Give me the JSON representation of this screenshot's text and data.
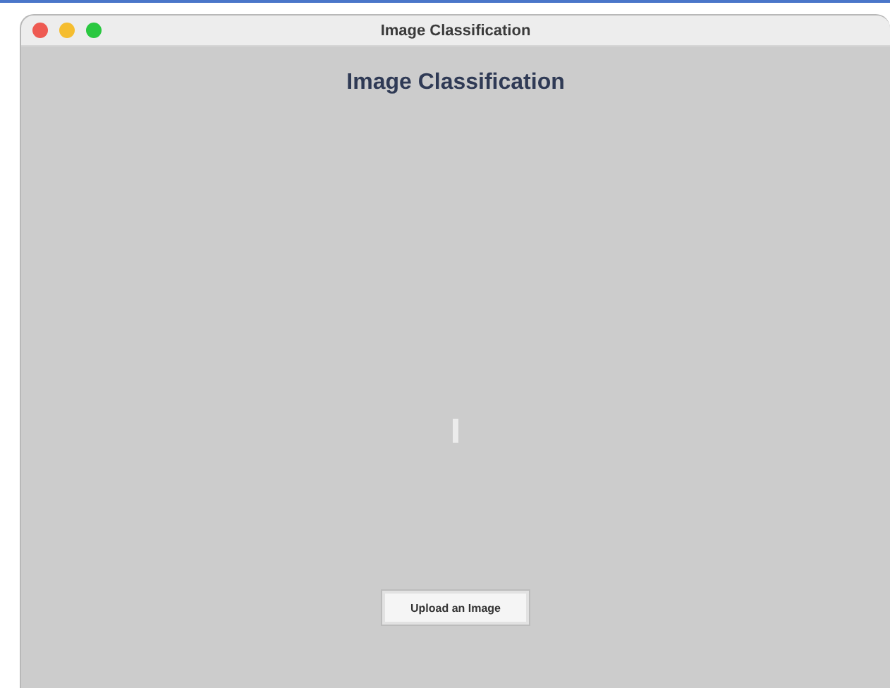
{
  "window": {
    "title": "Image Classification"
  },
  "heading": "Image Classification",
  "upload_button": {
    "label": "Upload an Image"
  }
}
